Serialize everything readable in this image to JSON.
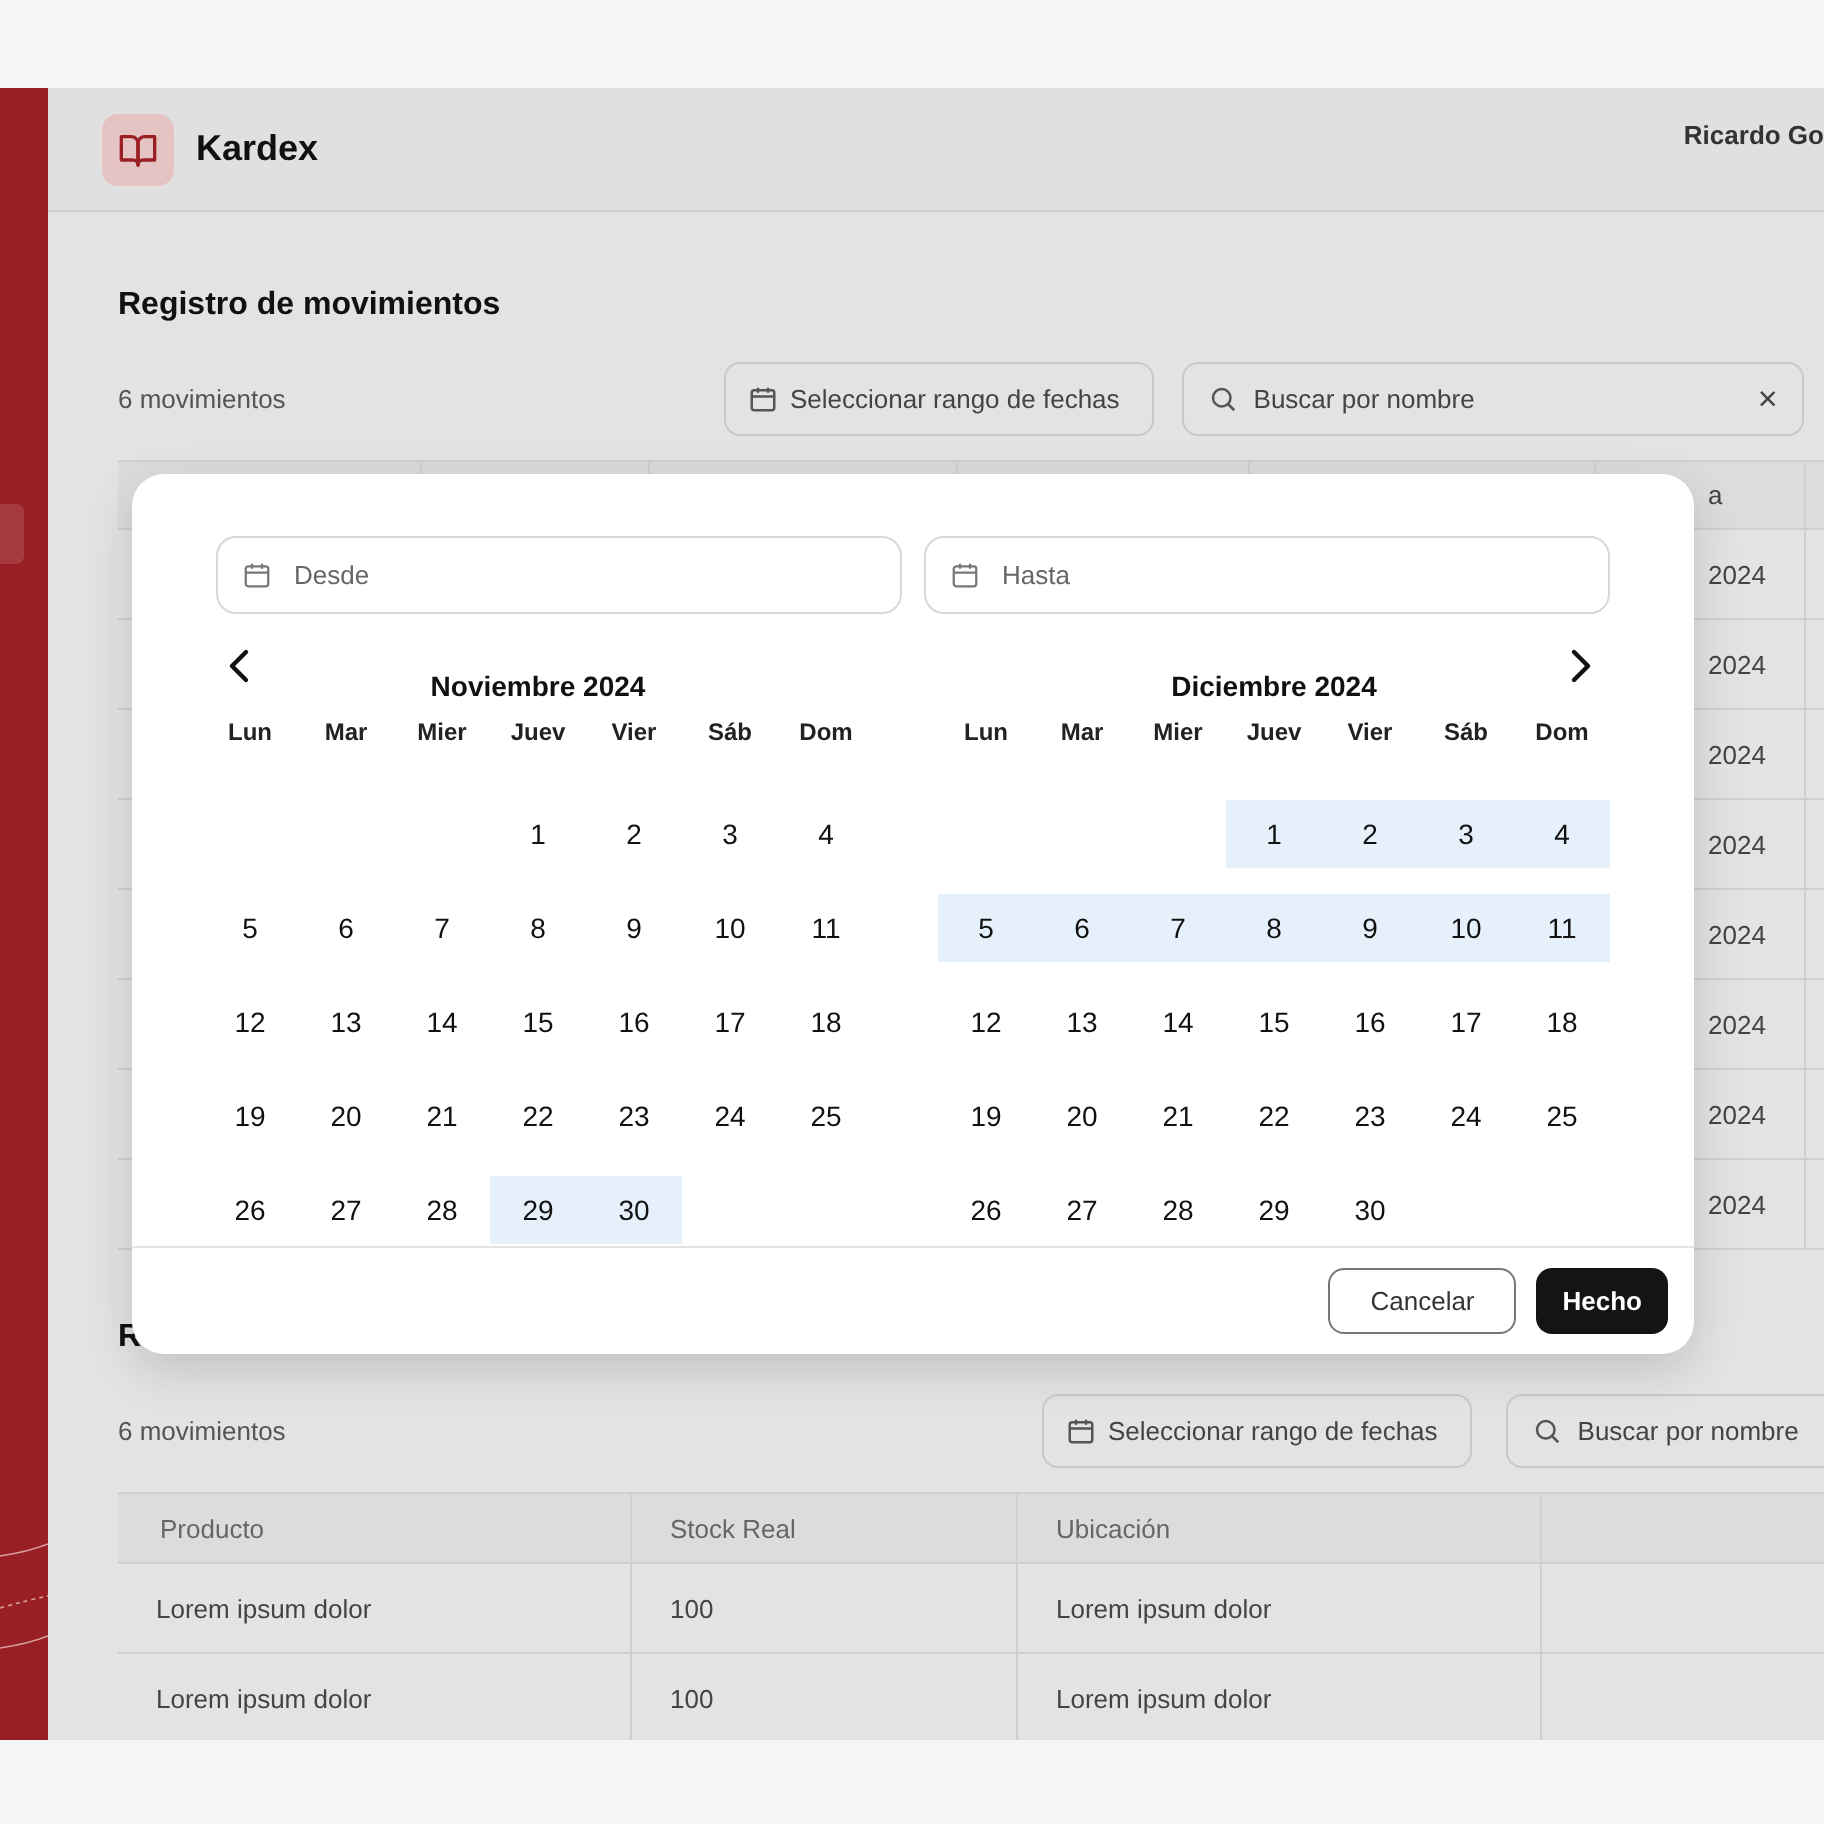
{
  "header": {
    "title": "Kardex",
    "user": "Ricardo Go"
  },
  "section1": {
    "title": "Registro de movimientos",
    "count": "6 movimientos",
    "date_button": "Seleccionar rango de fechas",
    "search": {
      "placeholder": "Buscar por nombre",
      "clear": "×"
    },
    "table": {
      "column_6": "a",
      "rows": [
        {
          "column_6": "2024"
        },
        {
          "column_6": "2024"
        },
        {
          "column_6": "2024"
        },
        {
          "column_6": "2024"
        },
        {
          "column_6": "2024"
        },
        {
          "column_6": "2024"
        },
        {
          "column_6": "2024"
        },
        {
          "column_6": "2024"
        }
      ]
    }
  },
  "section2": {
    "title": "R",
    "count": "6 movimientos",
    "date_button": "Seleccionar rango de fechas",
    "search": {
      "placeholder": "Buscar por nombre"
    },
    "table": {
      "columns": [
        "Producto",
        "Stock Real",
        "Ubicación"
      ],
      "rows": [
        {
          "cells": [
            "Lorem ipsum dolor",
            "100",
            "Lorem ipsum dolor"
          ]
        },
        {
          "cells": [
            "Lorem ipsum dolor",
            "100",
            "Lorem ipsum dolor"
          ]
        }
      ]
    }
  },
  "date_picker": {
    "from": {
      "placeholder": "Desde"
    },
    "to": {
      "placeholder": "Hasta"
    },
    "months": [
      {
        "title": "Noviembre 2024",
        "weekdays": [
          "Lun",
          "Mar",
          "Mier",
          "Juev",
          "Vier",
          "Sáb",
          "Dom"
        ],
        "weeks": [
          {
            "kind": "first",
            "days": [
              {
                "label": "1",
                "in_range": false
              },
              {
                "label": "2",
                "in_range": false
              },
              {
                "label": "3",
                "in_range": false
              },
              {
                "label": "4",
                "in_range": false
              }
            ]
          },
          {
            "kind": "week",
            "days": [
              {
                "label": "5",
                "in_range": false
              },
              {
                "label": "6",
                "in_range": false
              },
              {
                "label": "7",
                "in_range": false
              },
              {
                "label": "8",
                "in_range": false
              },
              {
                "label": "9",
                "in_range": false
              },
              {
                "label": "10",
                "in_range": false
              },
              {
                "label": "11",
                "in_range": false
              }
            ]
          },
          {
            "kind": "week",
            "days": [
              {
                "label": "12",
                "in_range": false
              },
              {
                "label": "13",
                "in_range": false
              },
              {
                "label": "14",
                "in_range": false
              },
              {
                "label": "15",
                "in_range": false
              },
              {
                "label": "16",
                "in_range": false
              },
              {
                "label": "17",
                "in_range": false
              },
              {
                "label": "18",
                "in_range": false
              }
            ]
          },
          {
            "kind": "week",
            "days": [
              {
                "label": "19",
                "in_range": false
              },
              {
                "label": "20",
                "in_range": false
              },
              {
                "label": "21",
                "in_range": false
              },
              {
                "label": "22",
                "in_range": false
              },
              {
                "label": "23",
                "in_range": false
              },
              {
                "label": "24",
                "in_range": false
              },
              {
                "label": "25",
                "in_range": false
              }
            ]
          },
          {
            "kind": "week",
            "days": [
              {
                "label": "26",
                "in_range": false
              },
              {
                "label": "27",
                "in_range": false
              },
              {
                "label": "28",
                "in_range": false
              },
              {
                "label": "29",
                "in_range": true
              },
              {
                "label": "30",
                "in_range": true
              }
            ]
          }
        ]
      },
      {
        "title": "Diciembre 2024",
        "weekdays": [
          "Lun",
          "Mar",
          "Mier",
          "Juev",
          "Vier",
          "Sáb",
          "Dom"
        ],
        "weeks": [
          {
            "kind": "first",
            "days": [
              {
                "label": "1",
                "in_range": true
              },
              {
                "label": "2",
                "in_range": true
              },
              {
                "label": "3",
                "in_range": true
              },
              {
                "label": "4",
                "in_range": true
              }
            ]
          },
          {
            "kind": "week",
            "days": [
              {
                "label": "5",
                "in_range": true
              },
              {
                "label": "6",
                "in_range": true
              },
              {
                "label": "7",
                "in_range": true
              },
              {
                "label": "8",
                "in_range": true
              },
              {
                "label": "9",
                "in_range": true
              },
              {
                "label": "10",
                "in_range": true
              },
              {
                "label": "11",
                "in_range": true
              }
            ]
          },
          {
            "kind": "week",
            "days": [
              {
                "label": "12",
                "in_range": false
              },
              {
                "label": "13",
                "in_range": false
              },
              {
                "label": "14",
                "in_range": false
              },
              {
                "label": "15",
                "in_range": false
              },
              {
                "label": "16",
                "in_range": false
              },
              {
                "label": "17",
                "in_range": false
              },
              {
                "label": "18",
                "in_range": false
              }
            ]
          },
          {
            "kind": "week",
            "days": [
              {
                "label": "19",
                "in_range": false
              },
              {
                "label": "20",
                "in_range": false
              },
              {
                "label": "21",
                "in_range": false
              },
              {
                "label": "22",
                "in_range": false
              },
              {
                "label": "23",
                "in_range": false
              },
              {
                "label": "24",
                "in_range": false
              },
              {
                "label": "25",
                "in_range": false
              }
            ]
          },
          {
            "kind": "week",
            "days": [
              {
                "label": "26",
                "in_range": false
              },
              {
                "label": "27",
                "in_range": false
              },
              {
                "label": "28",
                "in_range": false
              },
              {
                "label": "29",
                "in_range": false
              },
              {
                "label": "30",
                "in_range": false
              }
            ]
          }
        ]
      }
    ],
    "buttons": {
      "cancel": "Cancelar",
      "done": "Hecho"
    }
  }
}
